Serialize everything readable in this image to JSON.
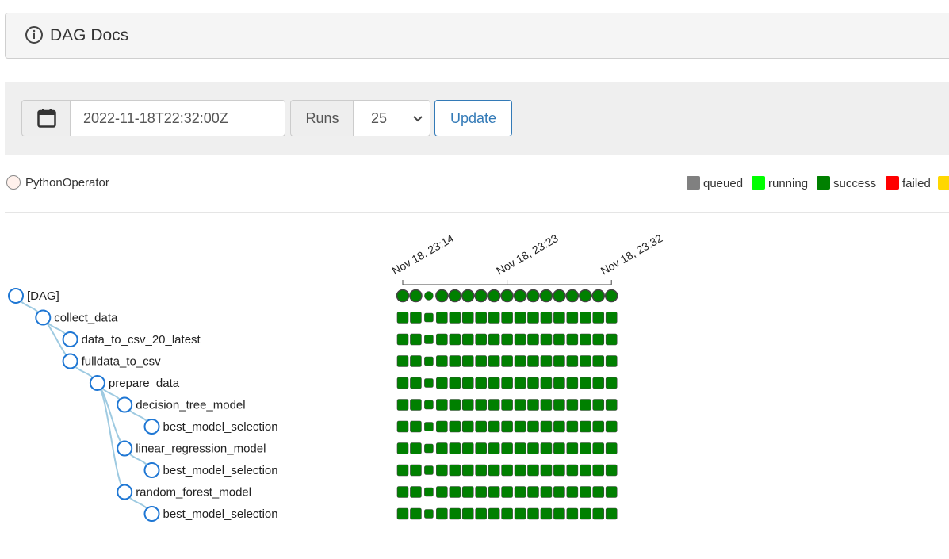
{
  "docs": {
    "title": "DAG Docs",
    "icon": "info-icon"
  },
  "controls": {
    "base_date": "2022-11-18T22:32:00Z",
    "runs_label": "Runs",
    "runs_value": "25",
    "update_label": "Update"
  },
  "operator_legend": {
    "label": "PythonOperator",
    "color": "#fff1ec"
  },
  "state_legend": [
    {
      "label": "queued",
      "color": "#808080"
    },
    {
      "label": "running",
      "color": "#00ff00"
    },
    {
      "label": "success",
      "color": "#008000"
    },
    {
      "label": "failed",
      "color": "#ff0000"
    },
    {
      "label": "",
      "color": "#ffd700"
    }
  ],
  "time_ticks": [
    "Nov 18, 23:14",
    "Nov 18, 23:23",
    "Nov 18, 23:32"
  ],
  "tree": [
    {
      "label": "[DAG]",
      "depth": 0,
      "parent": null
    },
    {
      "label": "collect_data",
      "depth": 1,
      "parent": 0
    },
    {
      "label": "data_to_csv_20_latest",
      "depth": 2,
      "parent": 1
    },
    {
      "label": "fulldata_to_csv",
      "depth": 2,
      "parent": 1
    },
    {
      "label": "prepare_data",
      "depth": 3,
      "parent": 3
    },
    {
      "label": "decision_tree_model",
      "depth": 4,
      "parent": 4
    },
    {
      "label": "best_model_selection",
      "depth": 5,
      "parent": 5
    },
    {
      "label": "linear_regression_model",
      "depth": 4,
      "parent": 4
    },
    {
      "label": "best_model_selection",
      "depth": 5,
      "parent": 7
    },
    {
      "label": "random_forest_model",
      "depth": 4,
      "parent": 4
    },
    {
      "label": "best_model_selection",
      "depth": 5,
      "parent": 9
    }
  ],
  "run_count": 17,
  "run_state": "success",
  "colors": {
    "success": "#008000",
    "link": "#337ab7",
    "tree_link": "#9ecae1"
  }
}
